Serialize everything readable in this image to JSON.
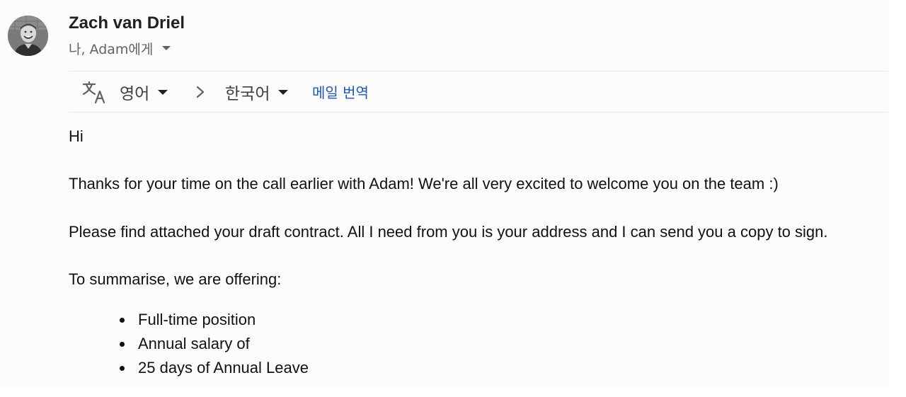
{
  "sender": {
    "name": "Zach van Driel",
    "recipients": "나, Adam에게"
  },
  "icons": {
    "avatar": "profile-photo",
    "recipients_toggle": "caret-down-icon",
    "translate": "translate-icon",
    "language_arrow": "chevron-right-icon"
  },
  "translate_bar": {
    "source_language": "영어",
    "target_language": "한국어",
    "action_label": "메일 번역"
  },
  "message": {
    "greeting": "Hi",
    "paragraph_1": "Thanks for your time on the call earlier with Adam! We're all very excited to welcome you on the team :)",
    "paragraph_2": "Please find attached your draft contract. All I need from you is your address and I can send you a copy to sign.",
    "paragraph_3": "To summarise, we are offering:",
    "offer_items": [
      "Full-time position",
      "Annual salary of",
      "25 days of Annual Leave"
    ]
  },
  "colors": {
    "link": "#1a56c7",
    "text": "#111111",
    "secondary_text": "#5f6368",
    "divider": "#e8eaed"
  }
}
